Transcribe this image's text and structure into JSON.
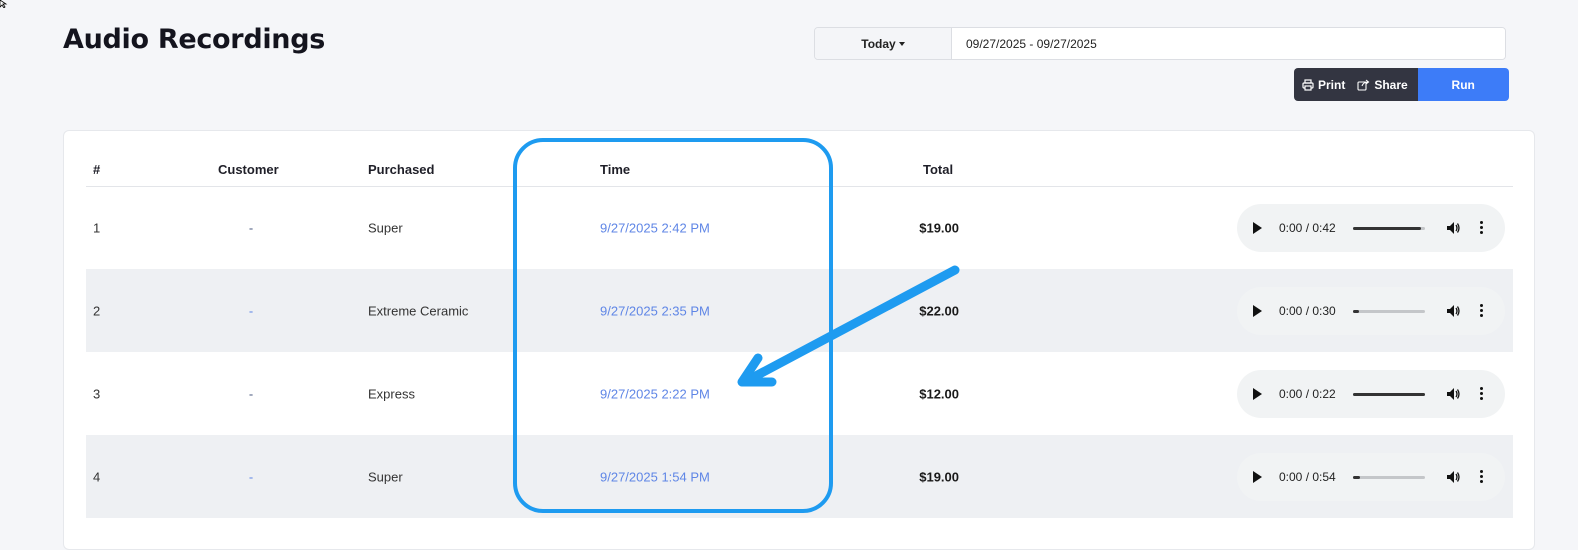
{
  "page": {
    "title": "Audio Recordings"
  },
  "filters": {
    "range_label": "Today",
    "date_range_value": "09/27/2025 - 09/27/2025"
  },
  "actions": {
    "print_label": "Print",
    "share_label": "Share",
    "run_label": "Run"
  },
  "table": {
    "columns": {
      "num": "#",
      "customer": "Customer",
      "purchased": "Purchased",
      "time": "Time",
      "total": "Total"
    },
    "rows": [
      {
        "num": "1",
        "customer": "-",
        "purchased": "Super",
        "time": "9/27/2025 2:42 PM",
        "total": "$19.00",
        "player": {
          "current": "0:00",
          "duration": "0:42",
          "display": "0:00 / 0:42",
          "buffered": 0.95
        }
      },
      {
        "num": "2",
        "customer": "-",
        "purchased": "Extreme Ceramic",
        "time": "9/27/2025 2:35 PM",
        "total": "$22.00",
        "player": {
          "current": "0:00",
          "duration": "0:30",
          "display": "0:00 / 0:30",
          "buffered": 0.08
        }
      },
      {
        "num": "3",
        "customer": "-",
        "purchased": "Express",
        "time": "9/27/2025 2:22 PM",
        "total": "$12.00",
        "player": {
          "current": "0:00",
          "duration": "0:22",
          "display": "0:00 / 0:22",
          "buffered": 1.0
        }
      },
      {
        "num": "4",
        "customer": "-",
        "purchased": "Super",
        "time": "9/27/2025 1:54 PM",
        "total": "$19.00",
        "player": {
          "current": "0:00",
          "duration": "0:54",
          "display": "0:00 / 0:54",
          "buffered": 0.1
        }
      }
    ]
  },
  "colors": {
    "accent": "#3d7cf8",
    "time_link": "#5f86e6",
    "annotation": "#1e9bf0",
    "dark_button": "#333541",
    "alt_row": "#eef0f3"
  },
  "icons": [
    "printer-icon",
    "share-icon",
    "play-icon",
    "volume-icon",
    "more-options-icon",
    "caret-down-icon"
  ]
}
